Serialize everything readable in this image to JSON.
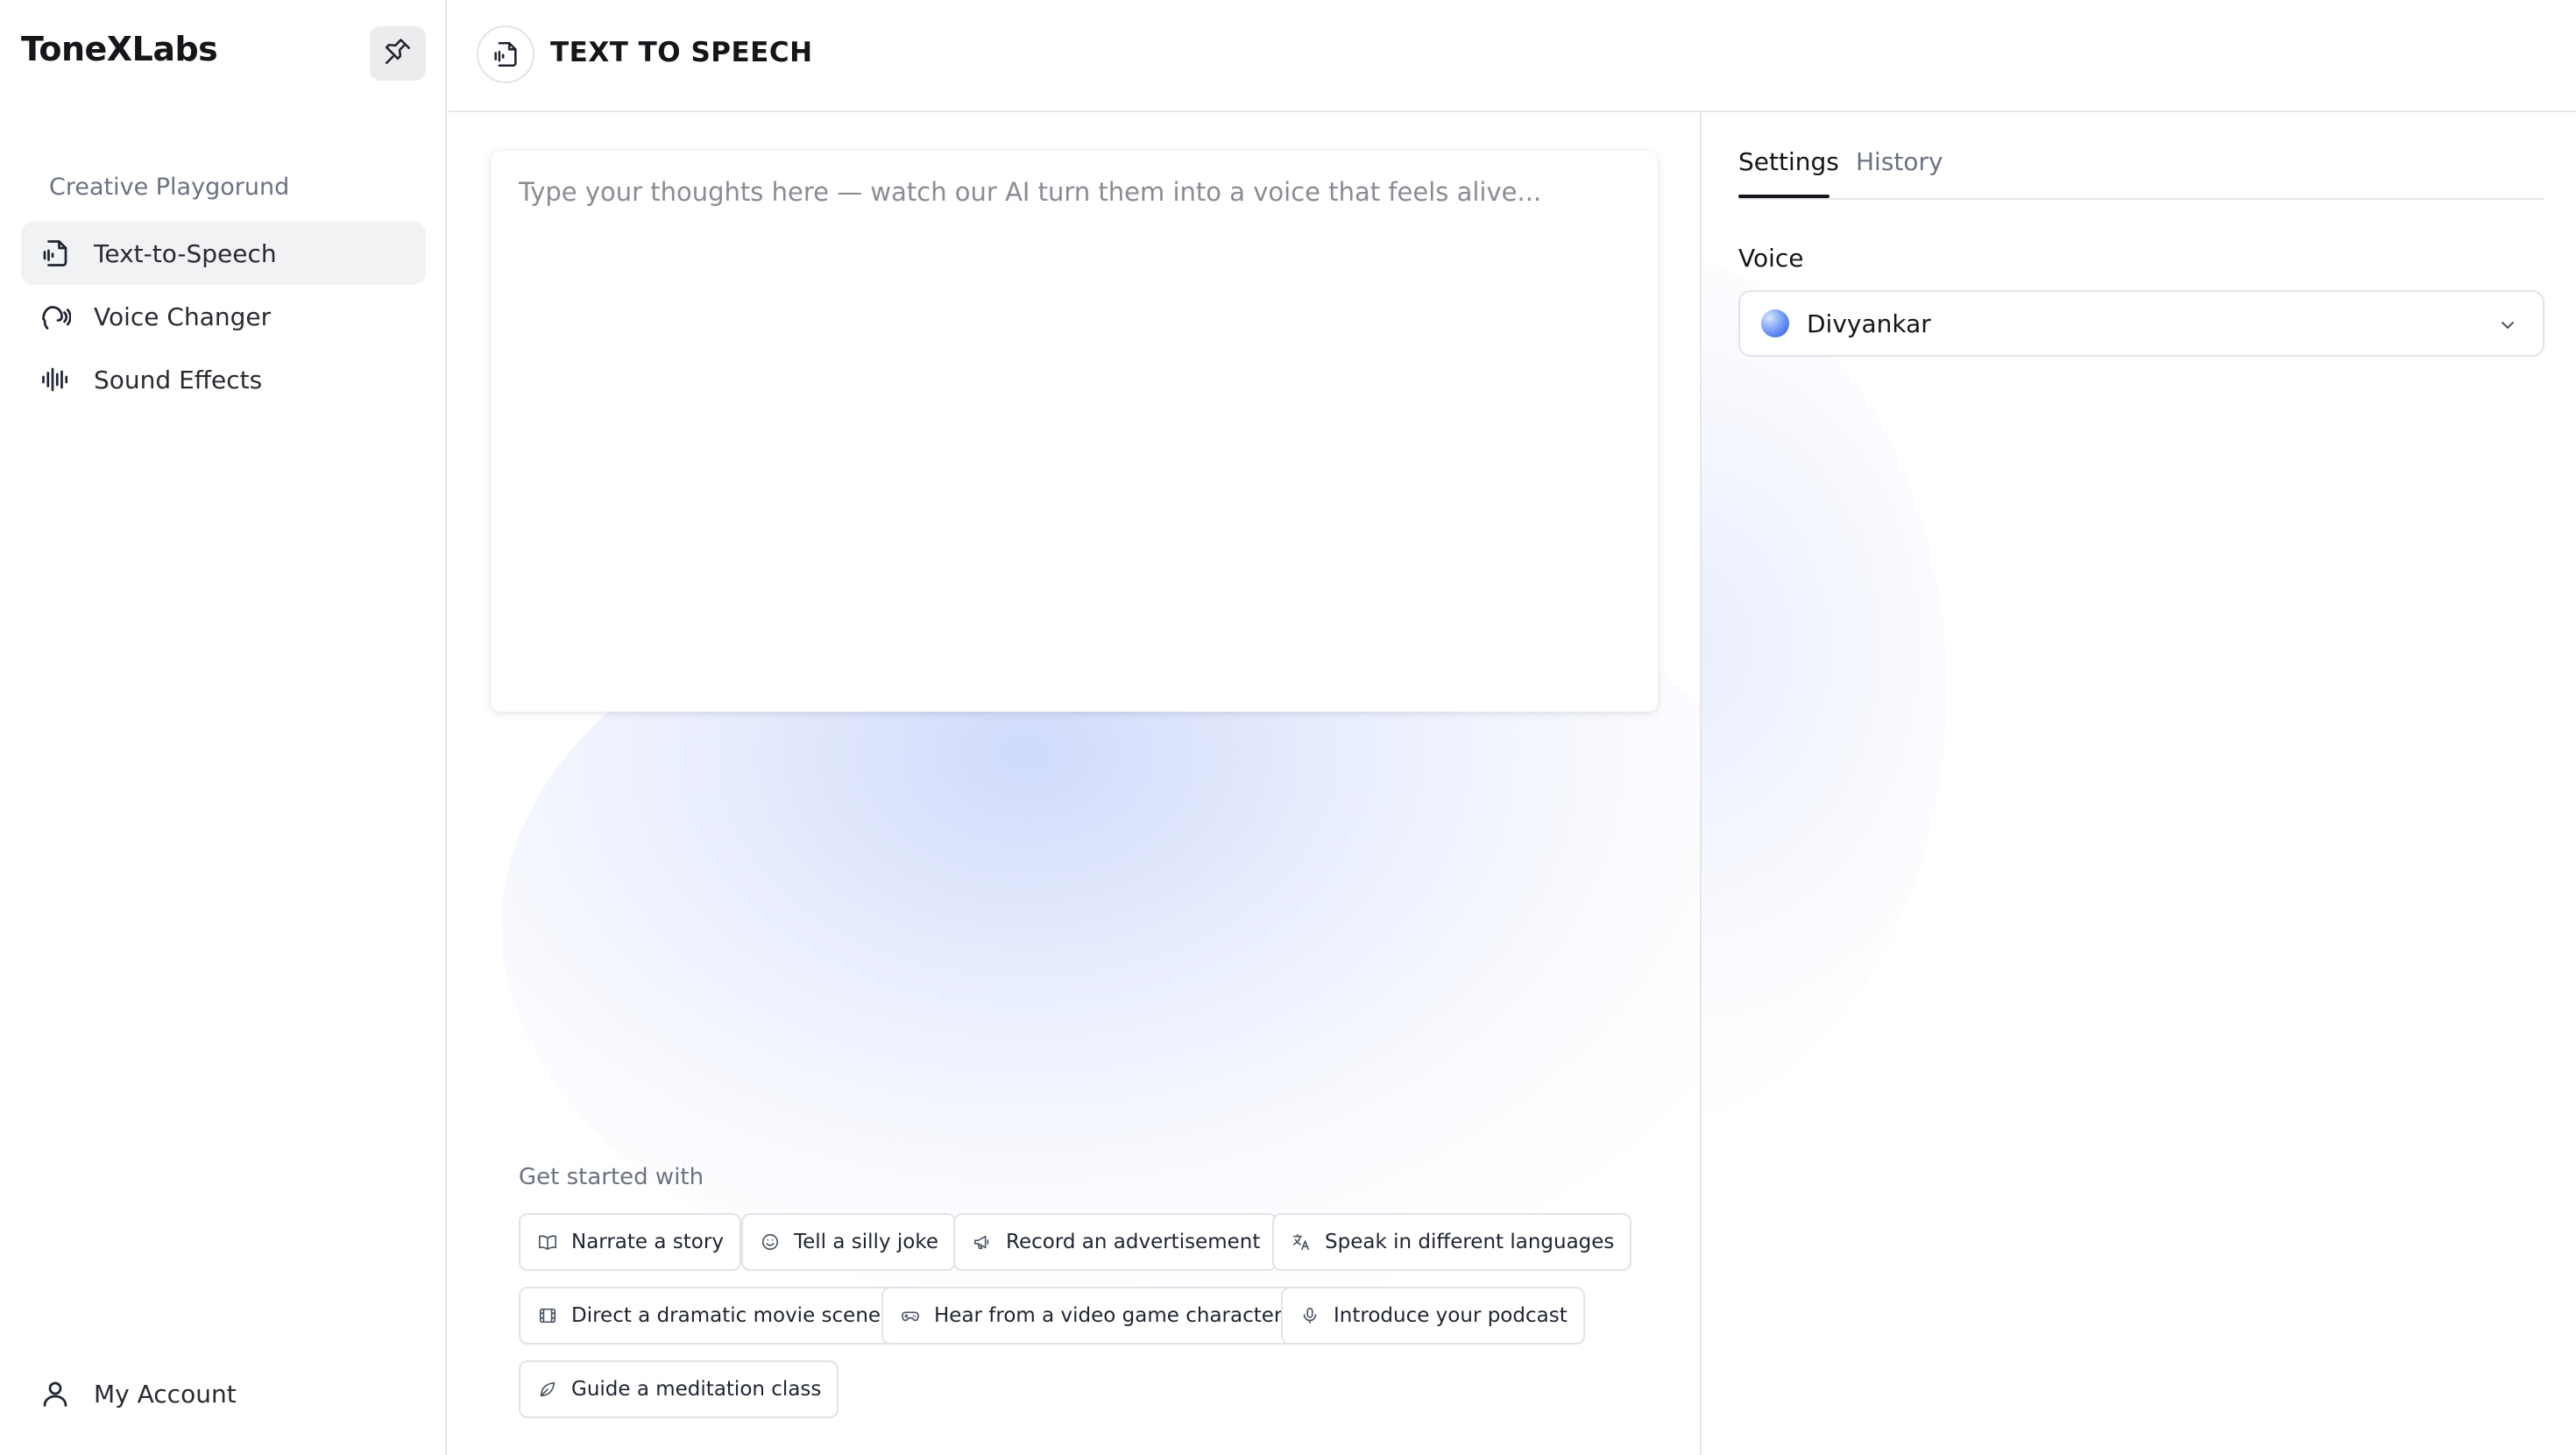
{
  "app": {
    "brand": "ToneXLabs"
  },
  "sidebar": {
    "section_label": "Creative Playgorund",
    "items": [
      {
        "label": "Text-to-Speech",
        "icon": "text-to-speech-icon",
        "active": true
      },
      {
        "label": "Voice Changer",
        "icon": "voice-changer-icon",
        "active": false
      },
      {
        "label": "Sound Effects",
        "icon": "sound-effects-icon",
        "active": false
      }
    ],
    "account_label": "My Account"
  },
  "header": {
    "title": "TEXT TO SPEECH",
    "icon": "text-to-speech-icon"
  },
  "editor": {
    "placeholder": "Type your thoughts here — watch our AI turn them into a voice that feels alive...",
    "value": ""
  },
  "get_started": {
    "label": "Get started with",
    "chips": [
      {
        "label": "Narrate a story",
        "icon": "book-icon"
      },
      {
        "label": "Tell a silly joke",
        "icon": "smile-icon"
      },
      {
        "label": "Record an advertisement",
        "icon": "megaphone-icon"
      },
      {
        "label": "Speak in different languages",
        "icon": "translate-icon"
      },
      {
        "label": "Direct a dramatic movie scene",
        "icon": "film-icon"
      },
      {
        "label": "Hear from a video game character",
        "icon": "gamepad-icon"
      },
      {
        "label": "Introduce your podcast",
        "icon": "microphone-icon"
      },
      {
        "label": "Guide a meditation class",
        "icon": "leaf-icon"
      }
    ]
  },
  "settings_panel": {
    "tabs": [
      {
        "label": "Settings",
        "active": true
      },
      {
        "label": "History",
        "active": false
      }
    ],
    "voice_label": "Voice",
    "voice_selected": "Divyankar"
  },
  "colors": {
    "accent_glow": "#c7d4fa",
    "text_primary": "#16161a",
    "text_muted": "#6b7280",
    "active_nav_bg": "#f1f2f3",
    "border": "#e3e3e7"
  }
}
